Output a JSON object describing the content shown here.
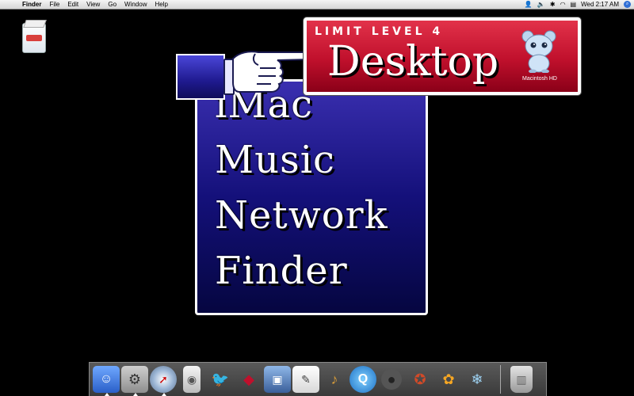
{
  "menubar": {
    "app": "Finder",
    "items": [
      "File",
      "Edit",
      "View",
      "Go",
      "Window",
      "Help"
    ],
    "clock": "Wed 2:17 AM",
    "status_icons": [
      "user-icon",
      "volume-icon",
      "bluetooth-icon",
      "wifi-icon",
      "flag-us-icon"
    ]
  },
  "desktop": {
    "drive_icon": "macintosh-hd-drive-icon"
  },
  "menu_panel": {
    "items": [
      "iMac",
      "Music",
      "Network",
      "Finder"
    ]
  },
  "banner": {
    "level": "LIMIT LEVEL 4",
    "title": "Desktop",
    "mascot_label": "Macintosh HD"
  },
  "dock": {
    "items": [
      "finder",
      "system-preferences",
      "safari",
      "ipod",
      "mail-bird",
      "red-bird",
      "iphoto",
      "textedit",
      "garageband",
      "quicktime",
      "bomb",
      "cat-toy",
      "goldfish",
      "snowflake-creature",
      "trash"
    ]
  },
  "colors": {
    "banner_red": "#c0102c",
    "panel_blue": "#14107a",
    "desktop_bg": "#000000"
  }
}
